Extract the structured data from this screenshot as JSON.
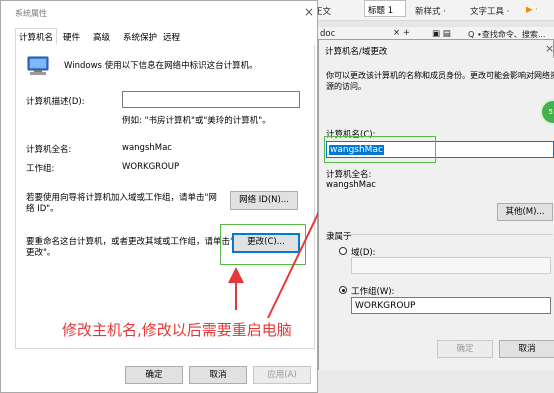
{
  "ribbon": {
    "body_text": "正文",
    "heading": "标题 1",
    "new_style": "新样式 ·",
    "text_tool": "文字工具 ·",
    "doc_tab": "doc",
    "search": "Q ∙查找命令、搜索..."
  },
  "sys_dialog": {
    "title": "系统属性",
    "tabs": [
      "计算机名",
      "硬件",
      "高级",
      "系统保护",
      "远程"
    ],
    "intro": "Windows 使用以下信息在网络中标识这台计算机。",
    "desc_label": "计算机描述(D):",
    "desc_value": "",
    "example": "例如: \"书房计算机\"或\"美玲的计算机\"。",
    "full_name_label": "计算机全名:",
    "full_name_value": "wangshMac",
    "workgroup_label": "工作组:",
    "workgroup_value": "WORKGROUP",
    "network_text_1": "若要使用向导将计算机加入域或工作组，请单击\"网",
    "network_text_2": "络 ID\"。",
    "network_button": "网络 ID(N)...",
    "rename_text_1": "要重命名这台计算机，或者更改其域或工作组，请单击\"",
    "rename_text_2": "更改\"。",
    "change_button": "更改(C)...",
    "ok_button": "确定",
    "cancel_button": "取消",
    "apply_button": "应用(A)"
  },
  "annotation": {
    "text": "修改主机名,修改以后需要重启电脑",
    "color": "#e53939"
  },
  "name_dialog": {
    "title": "计算机名/域更改",
    "intro_1": "你可以更改该计算机的名称和成员身份。更改可能会影响对网络资",
    "intro_2": "源的访问。",
    "name_label": "计算机名(C):",
    "name_value": "wangshMac",
    "full_name_label": "计算机全名:",
    "full_name_value": "wangshMac",
    "other_button": "其他(M)...",
    "member_of": "隶属于",
    "domain_label": "域(D):",
    "domain_value": "",
    "workgroup_label": "工作组(W):",
    "workgroup_value": "WORKGROUP",
    "ok_button": "确定",
    "cancel_button": "取消"
  },
  "badge": {
    "text": "51"
  },
  "colors": {
    "accent": "#0078d7",
    "highlight_box": "#58b94a"
  }
}
